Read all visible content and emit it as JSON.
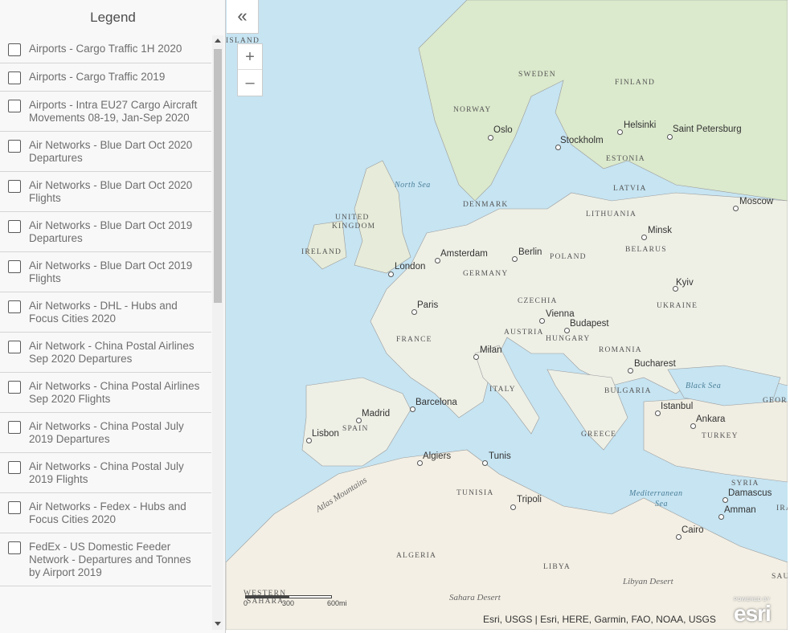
{
  "legend": {
    "title": "Legend",
    "items": [
      {
        "label": "Airports - Cargo Traffic 1H 2020"
      },
      {
        "label": "Airports - Cargo Traffic 2019"
      },
      {
        "label": "Airports - Intra EU27 Cargo Aircraft Movements 08-19, Jan-Sep 2020"
      },
      {
        "label": "Air Networks - Blue Dart Oct 2020 Departures"
      },
      {
        "label": "Air Networks - Blue Dart Oct 2020 Flights"
      },
      {
        "label": "Air Networks - Blue Dart Oct 2019 Departures"
      },
      {
        "label": "Air Networks - Blue Dart Oct 2019 Flights"
      },
      {
        "label": "Air Networks - DHL - Hubs and Focus Cities 2020"
      },
      {
        "label": "Air Network - China Postal Airlines Sep 2020 Departures"
      },
      {
        "label": "Air Networks - China Postal Airlines Sep 2020 Flights"
      },
      {
        "label": "Air Networks - China Postal July 2019 Departures"
      },
      {
        "label": "Air Networks - China Postal July 2019 Flights"
      },
      {
        "label": "Air Networks - Fedex - Hubs and Focus Cities 2020"
      },
      {
        "label": "FedEx - US Domestic Feeder Network - Departures and Tonnes by Airport 2019"
      }
    ]
  },
  "controls": {
    "collapse_icon": "«",
    "zoom_in": "+",
    "zoom_out": "–"
  },
  "map": {
    "cities": [
      "Oslo",
      "Stockholm",
      "Helsinki",
      "Saint Petersburg",
      "Moscow",
      "Minsk",
      "Kyiv",
      "Amsterdam",
      "Berlin",
      "London",
      "Paris",
      "Vienna",
      "Budapest",
      "Milan",
      "Bucharest",
      "Barcelona",
      "Madrid",
      "Lisbon",
      "Istanbul",
      "Ankara",
      "Algiers",
      "Tunis",
      "Tripoli",
      "Damascus",
      "Amman",
      "Cairo"
    ],
    "countries": [
      "SWEDEN",
      "FINLAND",
      "NORWAY",
      "ESTONIA",
      "LATVIA",
      "DENMARK",
      "LITHUANIA",
      "UNITED",
      "KINGDOM",
      "IRELAND",
      "BELARUS",
      "POLAND",
      "GERMANY",
      "CZECHIA",
      "UKRAINE",
      "AUSTRIA",
      "HUNGARY",
      "FRANCE",
      "ROMANIA",
      "ITALY",
      "BULGARIA",
      "SPAIN",
      "GREECE",
      "TURKEY",
      "TUNISIA",
      "SYRIA",
      "ALGERIA",
      "LIBYA",
      "GEORG",
      "IRA",
      "SAU",
      "WESTERN",
      "SAHARA",
      "ISLAND"
    ],
    "seas": [
      "North Sea",
      "Black Sea",
      "Mediterranean",
      "Sea"
    ],
    "features": [
      "Atlas Mountains",
      "Sahara Desert",
      "Libyan Desert"
    ]
  },
  "scalebar": {
    "a": "0",
    "b": "300",
    "c": "600mi"
  },
  "attribution": "Esri, USGS | Esri, HERE, Garmin, FAO, NOAA, USGS",
  "logo": {
    "powered": "POWERED BY",
    "name": "esri"
  },
  "colors": {
    "water": "#c6e4f2",
    "land": "#f1efe7",
    "green": "#d9e8c8",
    "border": "#9a9a9a"
  }
}
